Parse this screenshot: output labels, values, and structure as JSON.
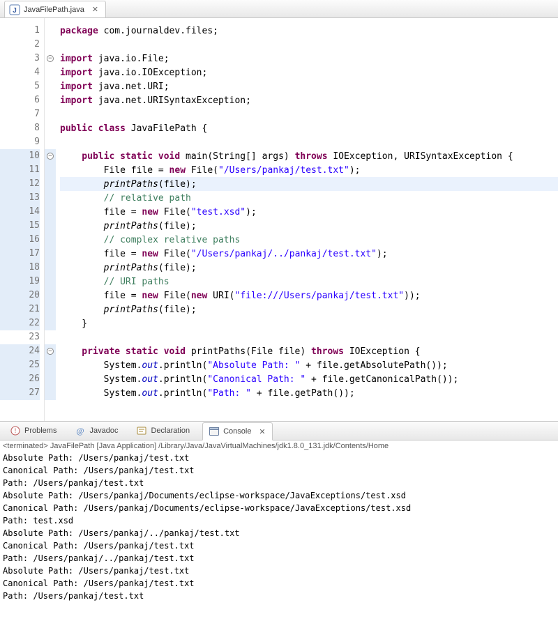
{
  "editor": {
    "tab_label": "JavaFilePath.java",
    "lines": [
      {
        "n": 1,
        "fold": "",
        "stripe": false,
        "tokens": [
          {
            "t": "package ",
            "c": "kw"
          },
          {
            "t": "com.journaldev.files;",
            "c": ""
          }
        ]
      },
      {
        "n": 2,
        "fold": "",
        "stripe": false,
        "tokens": []
      },
      {
        "n": 3,
        "fold": "minus",
        "stripe": false,
        "tokens": [
          {
            "t": "import ",
            "c": "kw"
          },
          {
            "t": "java.io.File;",
            "c": ""
          }
        ]
      },
      {
        "n": 4,
        "fold": "",
        "stripe": false,
        "tokens": [
          {
            "t": "import ",
            "c": "kw"
          },
          {
            "t": "java.io.IOException;",
            "c": ""
          }
        ]
      },
      {
        "n": 5,
        "fold": "",
        "stripe": false,
        "tokens": [
          {
            "t": "import ",
            "c": "kw"
          },
          {
            "t": "java.net.URI;",
            "c": ""
          }
        ]
      },
      {
        "n": 6,
        "fold": "",
        "stripe": false,
        "tokens": [
          {
            "t": "import ",
            "c": "kw"
          },
          {
            "t": "java.net.URISyntaxException;",
            "c": ""
          }
        ]
      },
      {
        "n": 7,
        "fold": "",
        "stripe": false,
        "tokens": []
      },
      {
        "n": 8,
        "fold": "",
        "stripe": false,
        "tokens": [
          {
            "t": "public class ",
            "c": "kw"
          },
          {
            "t": "JavaFilePath {",
            "c": ""
          }
        ]
      },
      {
        "n": 9,
        "fold": "",
        "stripe": false,
        "tokens": []
      },
      {
        "n": 10,
        "fold": "minus",
        "stripe": true,
        "tokens": [
          {
            "t": "    public static void ",
            "c": "kw"
          },
          {
            "t": "main(String[] args) ",
            "c": ""
          },
          {
            "t": "throws ",
            "c": "kw"
          },
          {
            "t": "IOException, URISyntaxException {",
            "c": ""
          }
        ]
      },
      {
        "n": 11,
        "fold": "",
        "stripe": true,
        "tokens": [
          {
            "t": "        File file = ",
            "c": ""
          },
          {
            "t": "new ",
            "c": "kw"
          },
          {
            "t": "File(",
            "c": ""
          },
          {
            "t": "\"/Users/pankaj/test.txt\"",
            "c": "str"
          },
          {
            "t": ");",
            "c": ""
          }
        ]
      },
      {
        "n": 12,
        "fold": "",
        "stripe": true,
        "hl": true,
        "tokens": [
          {
            "t": "        ",
            "c": ""
          },
          {
            "t": "printPaths",
            "c": "mcall-it"
          },
          {
            "t": "(file);",
            "c": ""
          }
        ]
      },
      {
        "n": 13,
        "fold": "",
        "stripe": true,
        "tokens": [
          {
            "t": "        ",
            "c": ""
          },
          {
            "t": "// relative path",
            "c": "cmt"
          }
        ]
      },
      {
        "n": 14,
        "fold": "",
        "stripe": true,
        "tokens": [
          {
            "t": "        file = ",
            "c": ""
          },
          {
            "t": "new ",
            "c": "kw"
          },
          {
            "t": "File(",
            "c": ""
          },
          {
            "t": "\"test.xsd\"",
            "c": "str"
          },
          {
            "t": ");",
            "c": ""
          }
        ]
      },
      {
        "n": 15,
        "fold": "",
        "stripe": true,
        "tokens": [
          {
            "t": "        ",
            "c": ""
          },
          {
            "t": "printPaths",
            "c": "mcall-it"
          },
          {
            "t": "(file);",
            "c": ""
          }
        ]
      },
      {
        "n": 16,
        "fold": "",
        "stripe": true,
        "tokens": [
          {
            "t": "        ",
            "c": ""
          },
          {
            "t": "// complex relative paths",
            "c": "cmt"
          }
        ]
      },
      {
        "n": 17,
        "fold": "",
        "stripe": true,
        "tokens": [
          {
            "t": "        file = ",
            "c": ""
          },
          {
            "t": "new ",
            "c": "kw"
          },
          {
            "t": "File(",
            "c": ""
          },
          {
            "t": "\"/Users/pankaj/../pankaj/test.txt\"",
            "c": "str"
          },
          {
            "t": ");",
            "c": ""
          }
        ]
      },
      {
        "n": 18,
        "fold": "",
        "stripe": true,
        "tokens": [
          {
            "t": "        ",
            "c": ""
          },
          {
            "t": "printPaths",
            "c": "mcall-it"
          },
          {
            "t": "(file);",
            "c": ""
          }
        ]
      },
      {
        "n": 19,
        "fold": "",
        "stripe": true,
        "tokens": [
          {
            "t": "        ",
            "c": ""
          },
          {
            "t": "// URI paths",
            "c": "cmt"
          }
        ]
      },
      {
        "n": 20,
        "fold": "",
        "stripe": true,
        "tokens": [
          {
            "t": "        file = ",
            "c": ""
          },
          {
            "t": "new ",
            "c": "kw"
          },
          {
            "t": "File(",
            "c": ""
          },
          {
            "t": "new ",
            "c": "kw"
          },
          {
            "t": "URI(",
            "c": ""
          },
          {
            "t": "\"file:///Users/pankaj/test.txt\"",
            "c": "str"
          },
          {
            "t": "));",
            "c": ""
          }
        ]
      },
      {
        "n": 21,
        "fold": "",
        "stripe": true,
        "tokens": [
          {
            "t": "        ",
            "c": ""
          },
          {
            "t": "printPaths",
            "c": "mcall-it"
          },
          {
            "t": "(file);",
            "c": ""
          }
        ]
      },
      {
        "n": 22,
        "fold": "",
        "stripe": true,
        "tokens": [
          {
            "t": "    }",
            "c": ""
          }
        ]
      },
      {
        "n": 23,
        "fold": "",
        "stripe": false,
        "tokens": []
      },
      {
        "n": 24,
        "fold": "minus",
        "stripe": true,
        "tokens": [
          {
            "t": "    private static void ",
            "c": "kw"
          },
          {
            "t": "printPaths(File file) ",
            "c": ""
          },
          {
            "t": "throws ",
            "c": "kw"
          },
          {
            "t": "IOException {",
            "c": ""
          }
        ]
      },
      {
        "n": 25,
        "fold": "",
        "stripe": true,
        "tokens": [
          {
            "t": "        System.",
            "c": ""
          },
          {
            "t": "out",
            "c": "fld"
          },
          {
            "t": ".println(",
            "c": ""
          },
          {
            "t": "\"Absolute Path: \"",
            "c": "str"
          },
          {
            "t": " + file.getAbsolutePath());",
            "c": ""
          }
        ]
      },
      {
        "n": 26,
        "fold": "",
        "stripe": true,
        "tokens": [
          {
            "t": "        System.",
            "c": ""
          },
          {
            "t": "out",
            "c": "fld"
          },
          {
            "t": ".println(",
            "c": ""
          },
          {
            "t": "\"Canonical Path: \"",
            "c": "str"
          },
          {
            "t": " + file.getCanonicalPath());",
            "c": ""
          }
        ]
      },
      {
        "n": 27,
        "fold": "",
        "stripe": true,
        "tokens": [
          {
            "t": "        System.",
            "c": ""
          },
          {
            "t": "out",
            "c": "fld"
          },
          {
            "t": ".println(",
            "c": ""
          },
          {
            "t": "\"Path: \"",
            "c": "str"
          },
          {
            "t": " + file.getPath());",
            "c": ""
          }
        ]
      }
    ]
  },
  "views": {
    "problems": "Problems",
    "javadoc": "Javadoc",
    "declaration": "Declaration",
    "console": "Console"
  },
  "console": {
    "header": "<terminated> JavaFilePath [Java Application] /Library/Java/JavaVirtualMachines/jdk1.8.0_131.jdk/Contents/Home",
    "lines": [
      "Absolute Path: /Users/pankaj/test.txt",
      "Canonical Path: /Users/pankaj/test.txt",
      "Path: /Users/pankaj/test.txt",
      "Absolute Path: /Users/pankaj/Documents/eclipse-workspace/JavaExceptions/test.xsd",
      "Canonical Path: /Users/pankaj/Documents/eclipse-workspace/JavaExceptions/test.xsd",
      "Path: test.xsd",
      "Absolute Path: /Users/pankaj/../pankaj/test.txt",
      "Canonical Path: /Users/pankaj/test.txt",
      "Path: /Users/pankaj/../pankaj/test.txt",
      "Absolute Path: /Users/pankaj/test.txt",
      "Canonical Path: /Users/pankaj/test.txt",
      "Path: /Users/pankaj/test.txt"
    ]
  }
}
